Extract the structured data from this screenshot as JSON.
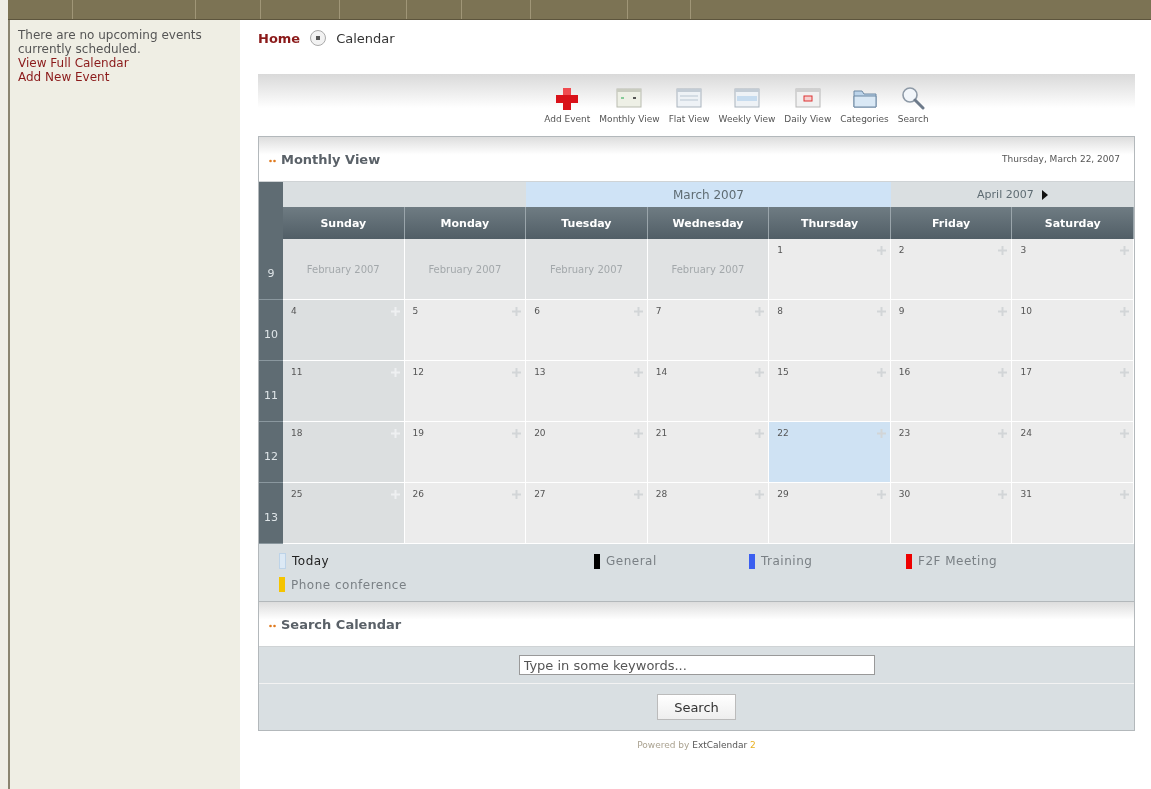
{
  "sidebar": {
    "message": "There are no upcoming events currently scheduled.",
    "links": [
      "View Full Calendar",
      "Add New Event"
    ]
  },
  "breadcrumb": [
    {
      "label": "Home",
      "kind": "link"
    },
    {
      "label": "Calendar",
      "kind": "current"
    }
  ],
  "toolbar": [
    {
      "label": "Add Event",
      "kind": "add"
    },
    {
      "label": "Monthly View",
      "kind": "monthly"
    },
    {
      "label": "Flat View",
      "kind": "flat"
    },
    {
      "label": "Weekly View",
      "kind": "weekly"
    },
    {
      "label": "Daily View",
      "kind": "daily"
    },
    {
      "label": "Categories",
      "kind": "categories"
    },
    {
      "label": "Search",
      "kind": "search"
    }
  ],
  "monthly_view": {
    "title": "Monthly View",
    "date": "Thursday, March 22, 2007",
    "current_month": "March 2007",
    "next_month": "April 2007",
    "days": [
      "Sunday",
      "Monday",
      "Tuesday",
      "Wednesday",
      "Thursday",
      "Friday",
      "Saturday"
    ],
    "weeks": [
      {
        "number": "9",
        "days": [
          {
            "label": "February 2007",
            "kind": "other"
          },
          {
            "label": "February 2007",
            "kind": "other"
          },
          {
            "label": "February 2007",
            "kind": "other"
          },
          {
            "label": "February 2007",
            "kind": "other"
          },
          {
            "label": "1",
            "kind": "day",
            "today": false
          },
          {
            "label": "2",
            "kind": "day",
            "today": false
          },
          {
            "label": "3",
            "kind": "day",
            "today": false
          }
        ]
      },
      {
        "number": "10",
        "days": [
          {
            "label": "4",
            "kind": "day",
            "today": false
          },
          {
            "label": "5",
            "kind": "day",
            "today": false
          },
          {
            "label": "6",
            "kind": "day",
            "today": false
          },
          {
            "label": "7",
            "kind": "day",
            "today": false
          },
          {
            "label": "8",
            "kind": "day",
            "today": false
          },
          {
            "label": "9",
            "kind": "day",
            "today": false
          },
          {
            "label": "10",
            "kind": "day",
            "today": false
          }
        ]
      },
      {
        "number": "11",
        "days": [
          {
            "label": "11",
            "kind": "day",
            "today": false
          },
          {
            "label": "12",
            "kind": "day",
            "today": false
          },
          {
            "label": "13",
            "kind": "day",
            "today": false
          },
          {
            "label": "14",
            "kind": "day",
            "today": false
          },
          {
            "label": "15",
            "kind": "day",
            "today": false
          },
          {
            "label": "16",
            "kind": "day",
            "today": false
          },
          {
            "label": "17",
            "kind": "day",
            "today": false
          }
        ]
      },
      {
        "number": "12",
        "days": [
          {
            "label": "18",
            "kind": "day",
            "today": false
          },
          {
            "label": "19",
            "kind": "day",
            "today": false
          },
          {
            "label": "20",
            "kind": "day",
            "today": false
          },
          {
            "label": "21",
            "kind": "day",
            "today": false
          },
          {
            "label": "22",
            "kind": "day",
            "today": true
          },
          {
            "label": "23",
            "kind": "day",
            "today": false
          },
          {
            "label": "24",
            "kind": "day",
            "today": false
          }
        ]
      },
      {
        "number": "13",
        "days": [
          {
            "label": "25",
            "kind": "day",
            "today": false
          },
          {
            "label": "26",
            "kind": "day",
            "today": false
          },
          {
            "label": "27",
            "kind": "day",
            "today": false
          },
          {
            "label": "28",
            "kind": "day",
            "today": false
          },
          {
            "label": "29",
            "kind": "day",
            "today": false
          },
          {
            "label": "30",
            "kind": "day",
            "today": false
          },
          {
            "label": "31",
            "kind": "day",
            "today": false
          }
        ]
      }
    ],
    "legend": [
      {
        "label": "Today",
        "kind": "today",
        "color": "#dce9f5"
      },
      {
        "label": "General",
        "kind": "category",
        "color": "#000000"
      },
      {
        "label": "Training",
        "kind": "category",
        "color": "#3b5ff0"
      },
      {
        "label": "F2F Meeting",
        "kind": "category",
        "color": "#ee0000"
      },
      {
        "label": "Phone conference",
        "kind": "category",
        "color": "#f5c400"
      }
    ]
  },
  "search_calendar": {
    "title": "Search Calendar",
    "placeholder": "Type in some keywords...",
    "button": "Search"
  },
  "footer": {
    "prefix": "Powered by",
    "product": "ExtCalendar",
    "version": "2"
  }
}
